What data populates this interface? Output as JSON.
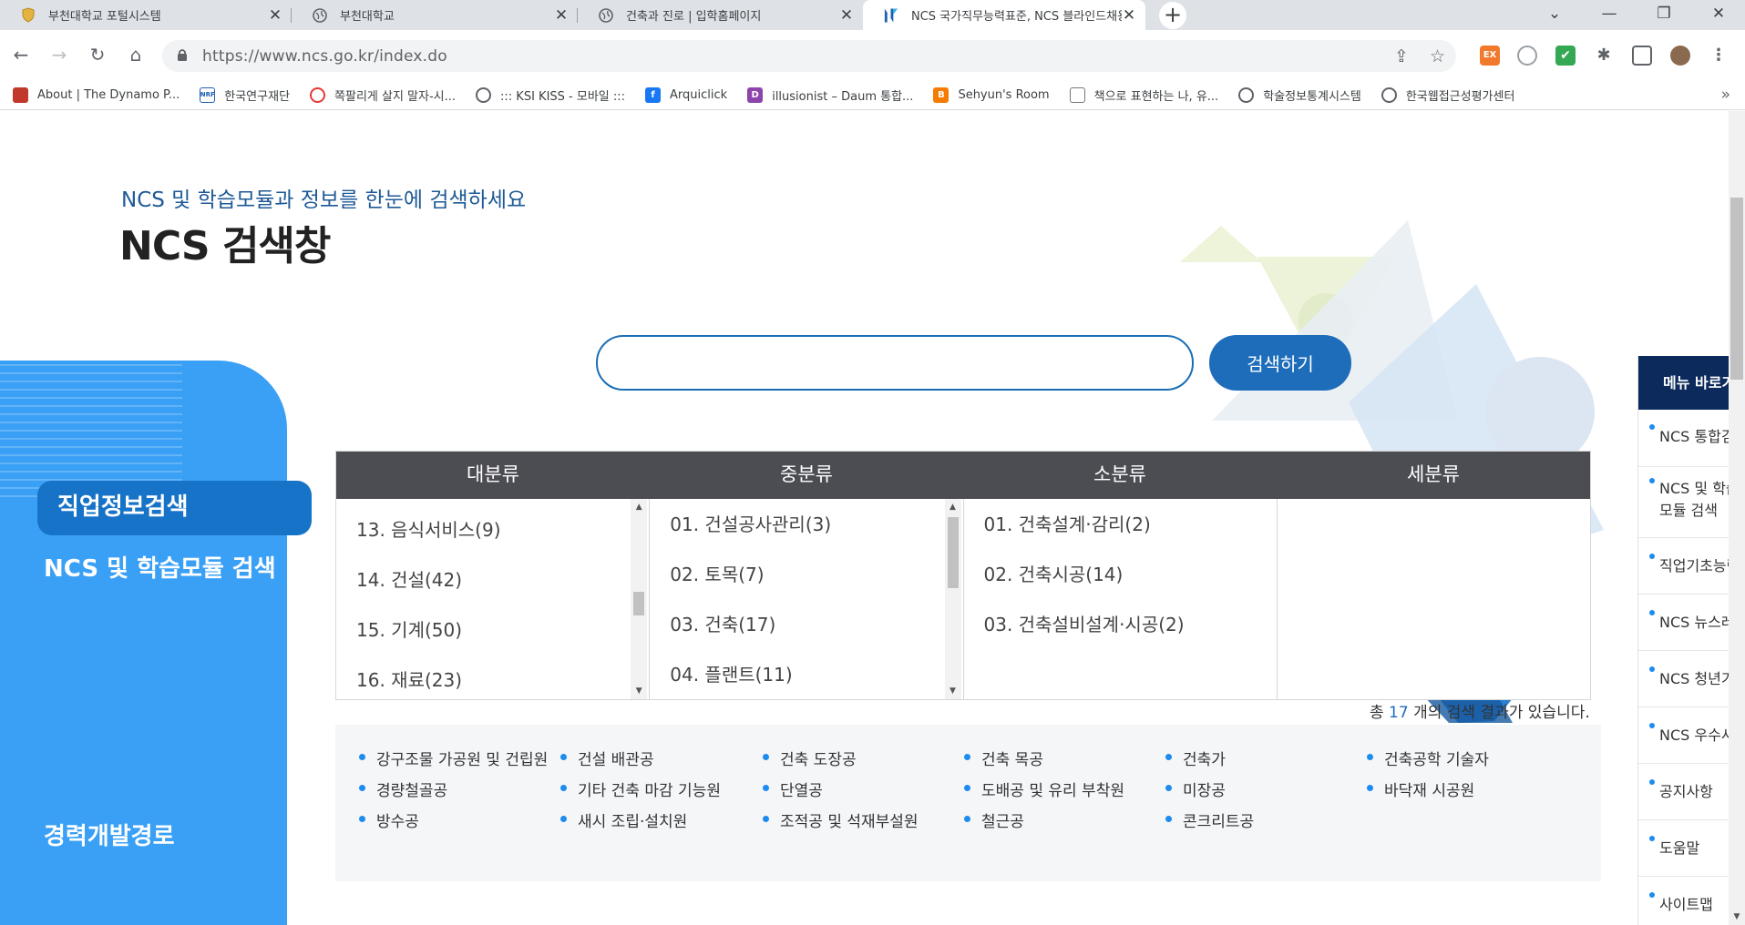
{
  "browser": {
    "tabs": [
      {
        "title": "부천대학교 포털시스템",
        "icon": "shield-icon"
      },
      {
        "title": "부천대학교",
        "icon": "globe-icon"
      },
      {
        "title": "건축과 진로 | 입학홈페이지",
        "icon": "globe-icon"
      },
      {
        "title": "NCS 국가직무능력표준, NCS 블라인드채용",
        "icon": "ncs-logo-icon"
      }
    ],
    "url": "https://www.ncs.go.kr/index.do",
    "bookmarks": [
      {
        "label": "About | The Dynamo P...",
        "icon": "dynamo-icon"
      },
      {
        "label": "한국연구재단",
        "icon": "nrf-icon"
      },
      {
        "label": "쪽팔리게 살지 말자-시...",
        "icon": "circle-logo-icon"
      },
      {
        "label": "::: KSI KISS - 모바일 :::",
        "icon": "globe-icon"
      },
      {
        "label": "Arquiclick",
        "icon": "facebook-icon"
      },
      {
        "label": "illusionist – Daum 통합...",
        "icon": "daum-icon"
      },
      {
        "label": "Sehyun's Room",
        "icon": "blogger-icon"
      },
      {
        "label": "책으로 표현하는 나, 유...",
        "icon": "book-icon"
      },
      {
        "label": "학술정보통계시스템",
        "icon": "globe-icon"
      },
      {
        "label": "한국웹접근성평가센터",
        "icon": "globe-icon"
      }
    ],
    "extension_ex": "EX"
  },
  "page": {
    "subtitle": "NCS 및 학습모듈과 정보를 한눈에 검색하세요",
    "heading": "NCS 검색창",
    "search_value": "",
    "search_button": "검색하기",
    "left_menu": {
      "item1": "NCS 및 학습모듈 검색",
      "item2": "직업정보검색",
      "item3": "경력개발경로"
    },
    "category_headers": [
      "대분류",
      "중분류",
      "소분류",
      "세분류"
    ],
    "major": [
      "13. 음식서비스(9)",
      "14. 건설(42)",
      "15. 기계(50)",
      "16. 재료(23)"
    ],
    "middle": [
      "01. 건설공사관리(3)",
      "02. 토목(7)",
      "03. 건축(17)",
      "04. 플랜트(11)"
    ],
    "minor": [
      "01. 건축설계·감리(2)",
      "02. 건축시공(14)",
      "03. 건축설비설계·시공(2)"
    ],
    "result_count": {
      "prefix": "총",
      "number": "17",
      "suffix": "개의 검색 결과가 있습니다."
    },
    "results": [
      [
        "강구조물 가공원 및 건립원",
        "건설 배관공",
        "건축 도장공",
        "건축 목공",
        "건축가",
        "건축공학 기술자"
      ],
      [
        "경량철골공",
        "기타 건축 마감 기능원",
        "단열공",
        "도배공 및 유리 부착원",
        "미장공",
        "바닥재 시공원"
      ],
      [
        "방수공",
        "새시 조립·설치원",
        "조적공 및 석재부설원",
        "철근공",
        "콘크리트공"
      ]
    ],
    "quick_menu": {
      "title": "메뉴 바로가기",
      "items": [
        "NCS 통합검색",
        "NCS 및 학습모듈 검색",
        "직업기초능력",
        "NCS 뉴스레터",
        "NCS 청년기자단",
        "NCS 우수사례",
        "공지사항",
        "도움말",
        "사이트맵"
      ]
    }
  },
  "colors": {
    "accent": "#1d6dbb",
    "left_panel": "#3aa0f5",
    "table_header": "#4c4d53",
    "quick_menu_header": "#0c2a5c"
  }
}
